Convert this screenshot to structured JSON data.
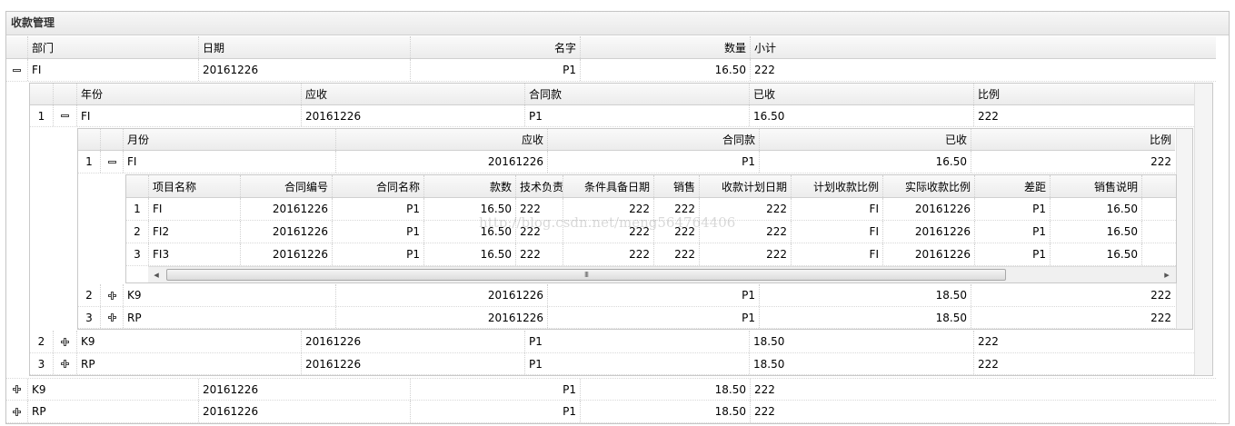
{
  "panel": {
    "title": "收款管理"
  },
  "outer": {
    "headers": [
      "部门",
      "日期",
      "名字",
      "数量",
      "小计"
    ],
    "rows": [
      {
        "dept": "FI",
        "date": "20161226",
        "name": "P1",
        "qty": "16.50",
        "sub": "222",
        "state": "expanded"
      },
      {
        "dept": "K9",
        "date": "20161226",
        "name": "P1",
        "qty": "18.50",
        "sub": "222",
        "state": "collapsed"
      },
      {
        "dept": "RP",
        "date": "20161226",
        "name": "P1",
        "qty": "18.50",
        "sub": "222",
        "state": "collapsed"
      }
    ]
  },
  "level2": {
    "headers": [
      "年份",
      "应收",
      "合同款",
      "已收",
      "比例"
    ],
    "rows": [
      {
        "num": "1",
        "year": "FI",
        "recv": "20161226",
        "contract": "P1",
        "got": "16.50",
        "ratio": "222",
        "state": "expanded"
      },
      {
        "num": "2",
        "year": "K9",
        "recv": "20161226",
        "contract": "P1",
        "got": "18.50",
        "ratio": "222",
        "state": "collapsed"
      },
      {
        "num": "3",
        "year": "RP",
        "recv": "20161226",
        "contract": "P1",
        "got": "18.50",
        "ratio": "222",
        "state": "collapsed"
      }
    ]
  },
  "level3": {
    "headers": [
      "月份",
      "应收",
      "合同款",
      "已收",
      "比例"
    ],
    "rows": [
      {
        "num": "1",
        "month": "FI",
        "recv": "20161226",
        "contract": "P1",
        "got": "16.50",
        "ratio": "222",
        "state": "expanded"
      },
      {
        "num": "2",
        "month": "K9",
        "recv": "20161226",
        "contract": "P1",
        "got": "18.50",
        "ratio": "222",
        "state": "collapsed"
      },
      {
        "num": "3",
        "month": "RP",
        "recv": "20161226",
        "contract": "P1",
        "got": "18.50",
        "ratio": "222",
        "state": "collapsed"
      }
    ]
  },
  "level4": {
    "headers": [
      "项目名称",
      "合同编号",
      "合同名称",
      "款数",
      "技术负责",
      "条件具备日期",
      "销售",
      "收款计划日期",
      "计划收款比例",
      "实际收款比例",
      "差距",
      "销售说明"
    ],
    "rows": [
      {
        "num": "1",
        "cells": [
          "FI",
          "20161226",
          "P1",
          "16.50",
          "222",
          "222",
          "222",
          "222",
          "FI",
          "20161226",
          "P1",
          "16.50"
        ]
      },
      {
        "num": "2",
        "cells": [
          "FI2",
          "20161226",
          "P1",
          "16.50",
          "222",
          "222",
          "222",
          "222",
          "FI",
          "20161226",
          "P1",
          "16.50"
        ]
      },
      {
        "num": "3",
        "cells": [
          "FI3",
          "20161226",
          "P1",
          "16.50",
          "222",
          "222",
          "222",
          "222",
          "FI",
          "20161226",
          "P1",
          "16.50"
        ]
      }
    ],
    "scroll": {
      "left_arrow": "◂",
      "right_arrow": "▸",
      "grip": "III"
    }
  },
  "watermark": "http://blog.csdn.net/meng564764406"
}
